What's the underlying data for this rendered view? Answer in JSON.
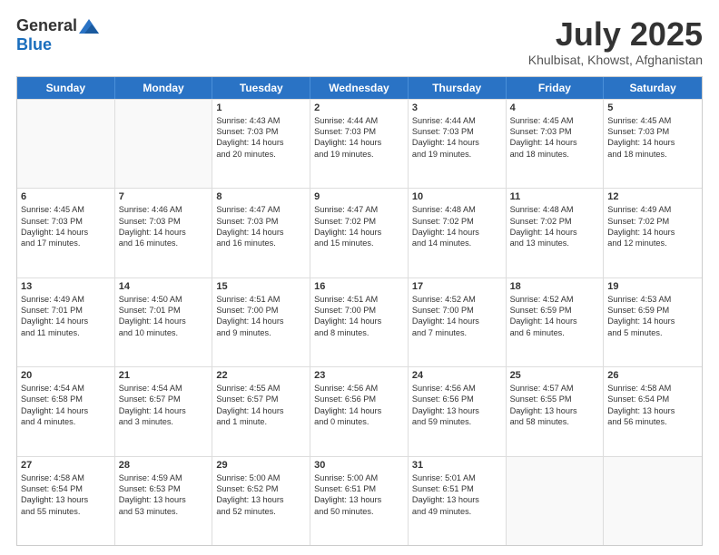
{
  "header": {
    "logo_general": "General",
    "logo_blue": "Blue",
    "month_title": "July 2025",
    "location": "Khulbisat, Khowst, Afghanistan"
  },
  "days_of_week": [
    "Sunday",
    "Monday",
    "Tuesday",
    "Wednesday",
    "Thursday",
    "Friday",
    "Saturday"
  ],
  "rows": [
    [
      {
        "day": "",
        "lines": [],
        "empty": true
      },
      {
        "day": "",
        "lines": [],
        "empty": true
      },
      {
        "day": "1",
        "lines": [
          "Sunrise: 4:43 AM",
          "Sunset: 7:03 PM",
          "Daylight: 14 hours",
          "and 20 minutes."
        ]
      },
      {
        "day": "2",
        "lines": [
          "Sunrise: 4:44 AM",
          "Sunset: 7:03 PM",
          "Daylight: 14 hours",
          "and 19 minutes."
        ]
      },
      {
        "day": "3",
        "lines": [
          "Sunrise: 4:44 AM",
          "Sunset: 7:03 PM",
          "Daylight: 14 hours",
          "and 19 minutes."
        ]
      },
      {
        "day": "4",
        "lines": [
          "Sunrise: 4:45 AM",
          "Sunset: 7:03 PM",
          "Daylight: 14 hours",
          "and 18 minutes."
        ]
      },
      {
        "day": "5",
        "lines": [
          "Sunrise: 4:45 AM",
          "Sunset: 7:03 PM",
          "Daylight: 14 hours",
          "and 18 minutes."
        ]
      }
    ],
    [
      {
        "day": "6",
        "lines": [
          "Sunrise: 4:45 AM",
          "Sunset: 7:03 PM",
          "Daylight: 14 hours",
          "and 17 minutes."
        ]
      },
      {
        "day": "7",
        "lines": [
          "Sunrise: 4:46 AM",
          "Sunset: 7:03 PM",
          "Daylight: 14 hours",
          "and 16 minutes."
        ]
      },
      {
        "day": "8",
        "lines": [
          "Sunrise: 4:47 AM",
          "Sunset: 7:03 PM",
          "Daylight: 14 hours",
          "and 16 minutes."
        ]
      },
      {
        "day": "9",
        "lines": [
          "Sunrise: 4:47 AM",
          "Sunset: 7:02 PM",
          "Daylight: 14 hours",
          "and 15 minutes."
        ]
      },
      {
        "day": "10",
        "lines": [
          "Sunrise: 4:48 AM",
          "Sunset: 7:02 PM",
          "Daylight: 14 hours",
          "and 14 minutes."
        ]
      },
      {
        "day": "11",
        "lines": [
          "Sunrise: 4:48 AM",
          "Sunset: 7:02 PM",
          "Daylight: 14 hours",
          "and 13 minutes."
        ]
      },
      {
        "day": "12",
        "lines": [
          "Sunrise: 4:49 AM",
          "Sunset: 7:02 PM",
          "Daylight: 14 hours",
          "and 12 minutes."
        ]
      }
    ],
    [
      {
        "day": "13",
        "lines": [
          "Sunrise: 4:49 AM",
          "Sunset: 7:01 PM",
          "Daylight: 14 hours",
          "and 11 minutes."
        ]
      },
      {
        "day": "14",
        "lines": [
          "Sunrise: 4:50 AM",
          "Sunset: 7:01 PM",
          "Daylight: 14 hours",
          "and 10 minutes."
        ]
      },
      {
        "day": "15",
        "lines": [
          "Sunrise: 4:51 AM",
          "Sunset: 7:00 PM",
          "Daylight: 14 hours",
          "and 9 minutes."
        ]
      },
      {
        "day": "16",
        "lines": [
          "Sunrise: 4:51 AM",
          "Sunset: 7:00 PM",
          "Daylight: 14 hours",
          "and 8 minutes."
        ]
      },
      {
        "day": "17",
        "lines": [
          "Sunrise: 4:52 AM",
          "Sunset: 7:00 PM",
          "Daylight: 14 hours",
          "and 7 minutes."
        ]
      },
      {
        "day": "18",
        "lines": [
          "Sunrise: 4:52 AM",
          "Sunset: 6:59 PM",
          "Daylight: 14 hours",
          "and 6 minutes."
        ]
      },
      {
        "day": "19",
        "lines": [
          "Sunrise: 4:53 AM",
          "Sunset: 6:59 PM",
          "Daylight: 14 hours",
          "and 5 minutes."
        ]
      }
    ],
    [
      {
        "day": "20",
        "lines": [
          "Sunrise: 4:54 AM",
          "Sunset: 6:58 PM",
          "Daylight: 14 hours",
          "and 4 minutes."
        ]
      },
      {
        "day": "21",
        "lines": [
          "Sunrise: 4:54 AM",
          "Sunset: 6:57 PM",
          "Daylight: 14 hours",
          "and 3 minutes."
        ]
      },
      {
        "day": "22",
        "lines": [
          "Sunrise: 4:55 AM",
          "Sunset: 6:57 PM",
          "Daylight: 14 hours",
          "and 1 minute."
        ]
      },
      {
        "day": "23",
        "lines": [
          "Sunrise: 4:56 AM",
          "Sunset: 6:56 PM",
          "Daylight: 14 hours",
          "and 0 minutes."
        ]
      },
      {
        "day": "24",
        "lines": [
          "Sunrise: 4:56 AM",
          "Sunset: 6:56 PM",
          "Daylight: 13 hours",
          "and 59 minutes."
        ]
      },
      {
        "day": "25",
        "lines": [
          "Sunrise: 4:57 AM",
          "Sunset: 6:55 PM",
          "Daylight: 13 hours",
          "and 58 minutes."
        ]
      },
      {
        "day": "26",
        "lines": [
          "Sunrise: 4:58 AM",
          "Sunset: 6:54 PM",
          "Daylight: 13 hours",
          "and 56 minutes."
        ]
      }
    ],
    [
      {
        "day": "27",
        "lines": [
          "Sunrise: 4:58 AM",
          "Sunset: 6:54 PM",
          "Daylight: 13 hours",
          "and 55 minutes."
        ]
      },
      {
        "day": "28",
        "lines": [
          "Sunrise: 4:59 AM",
          "Sunset: 6:53 PM",
          "Daylight: 13 hours",
          "and 53 minutes."
        ]
      },
      {
        "day": "29",
        "lines": [
          "Sunrise: 5:00 AM",
          "Sunset: 6:52 PM",
          "Daylight: 13 hours",
          "and 52 minutes."
        ]
      },
      {
        "day": "30",
        "lines": [
          "Sunrise: 5:00 AM",
          "Sunset: 6:51 PM",
          "Daylight: 13 hours",
          "and 50 minutes."
        ]
      },
      {
        "day": "31",
        "lines": [
          "Sunrise: 5:01 AM",
          "Sunset: 6:51 PM",
          "Daylight: 13 hours",
          "and 49 minutes."
        ]
      },
      {
        "day": "",
        "lines": [],
        "empty": true
      },
      {
        "day": "",
        "lines": [],
        "empty": true
      }
    ]
  ]
}
